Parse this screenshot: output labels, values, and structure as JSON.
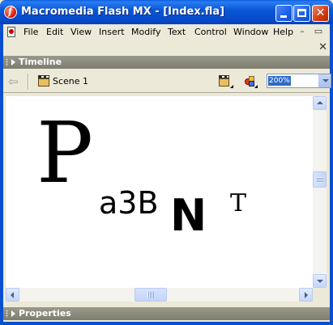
{
  "window": {
    "title": "Macromedia Flash MX - [Index.fla]",
    "controls": {
      "minimize": "minimize",
      "maximize": "maximize",
      "close": "✕"
    }
  },
  "menu": {
    "items": [
      "File",
      "Edit",
      "View",
      "Insert",
      "Modify",
      "Text",
      "Control",
      "Window",
      "Help"
    ],
    "mdi_minimize": "–",
    "mdi_restore": "▭",
    "doc_close": "✕"
  },
  "timeline": {
    "label": "Timeline"
  },
  "editbar": {
    "scene_label": "Scene 1",
    "zoom_value": "200%",
    "icons": [
      "back-arrow-icon",
      "scene-icon",
      "edit-scene-icon",
      "edit-symbol-icon"
    ]
  },
  "stage": {
    "letters": {
      "p": "P",
      "a3b": "a3B",
      "n": "N",
      "t": "T"
    }
  },
  "properties": {
    "label": "Properties"
  },
  "colors": {
    "titlebar": "#0a58d8",
    "panel_header": "#8c8b7d",
    "stage": "#ffffff",
    "zoom_highlight": "#316ac5"
  }
}
